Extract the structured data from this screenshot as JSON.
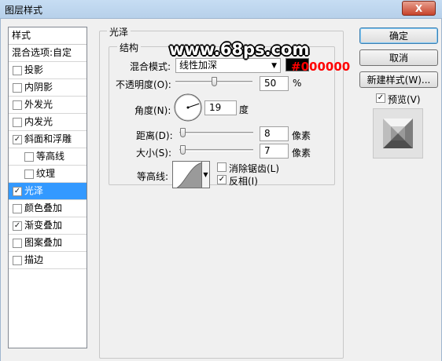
{
  "window": {
    "title": "图层样式",
    "close_label": "X"
  },
  "style_list": {
    "header": "样式",
    "blend_options": "混合选项:自定",
    "items": [
      {
        "label": "投影",
        "checked": false,
        "indent": false
      },
      {
        "label": "内阴影",
        "checked": false,
        "indent": false
      },
      {
        "label": "外发光",
        "checked": false,
        "indent": false
      },
      {
        "label": "内发光",
        "checked": false,
        "indent": false
      },
      {
        "label": "斜面和浮雕",
        "checked": true,
        "indent": false
      },
      {
        "label": "等高线",
        "checked": false,
        "indent": true
      },
      {
        "label": "纹理",
        "checked": false,
        "indent": true
      },
      {
        "label": "光泽",
        "checked": true,
        "indent": false,
        "selected": true
      },
      {
        "label": "颜色叠加",
        "checked": false,
        "indent": false
      },
      {
        "label": "渐变叠加",
        "checked": true,
        "indent": false
      },
      {
        "label": "图案叠加",
        "checked": false,
        "indent": false
      },
      {
        "label": "描边",
        "checked": false,
        "indent": false
      }
    ]
  },
  "satin": {
    "group_title": "光泽",
    "structure_title": "结构",
    "blend_mode_label": "混合模式:",
    "blend_mode_value": "线性加深",
    "color": "#000000",
    "opacity_label": "不透明度(O):",
    "opacity_value": "50",
    "opacity_unit": "%",
    "opacity_fraction": 0.5,
    "angle_label": "角度(N):",
    "angle_value": "19",
    "angle_unit": "度",
    "distance_label": "距离(D):",
    "distance_value": "8",
    "distance_unit": "像素",
    "size_label": "大小(S):",
    "size_value": "7",
    "size_unit": "像素",
    "contour_label": "等高线:",
    "antialias_label": "消除锯齿(L)",
    "antialias_checked": false,
    "invert_label": "反相(I)",
    "invert_checked": true
  },
  "buttons": {
    "ok": "确定",
    "cancel": "取消",
    "new_style": "新建样式(W)...",
    "preview_label": "预览(V)",
    "preview_checked": true
  },
  "overlay": {
    "watermark": "www.68ps.com",
    "color_annotation": "#000000"
  }
}
